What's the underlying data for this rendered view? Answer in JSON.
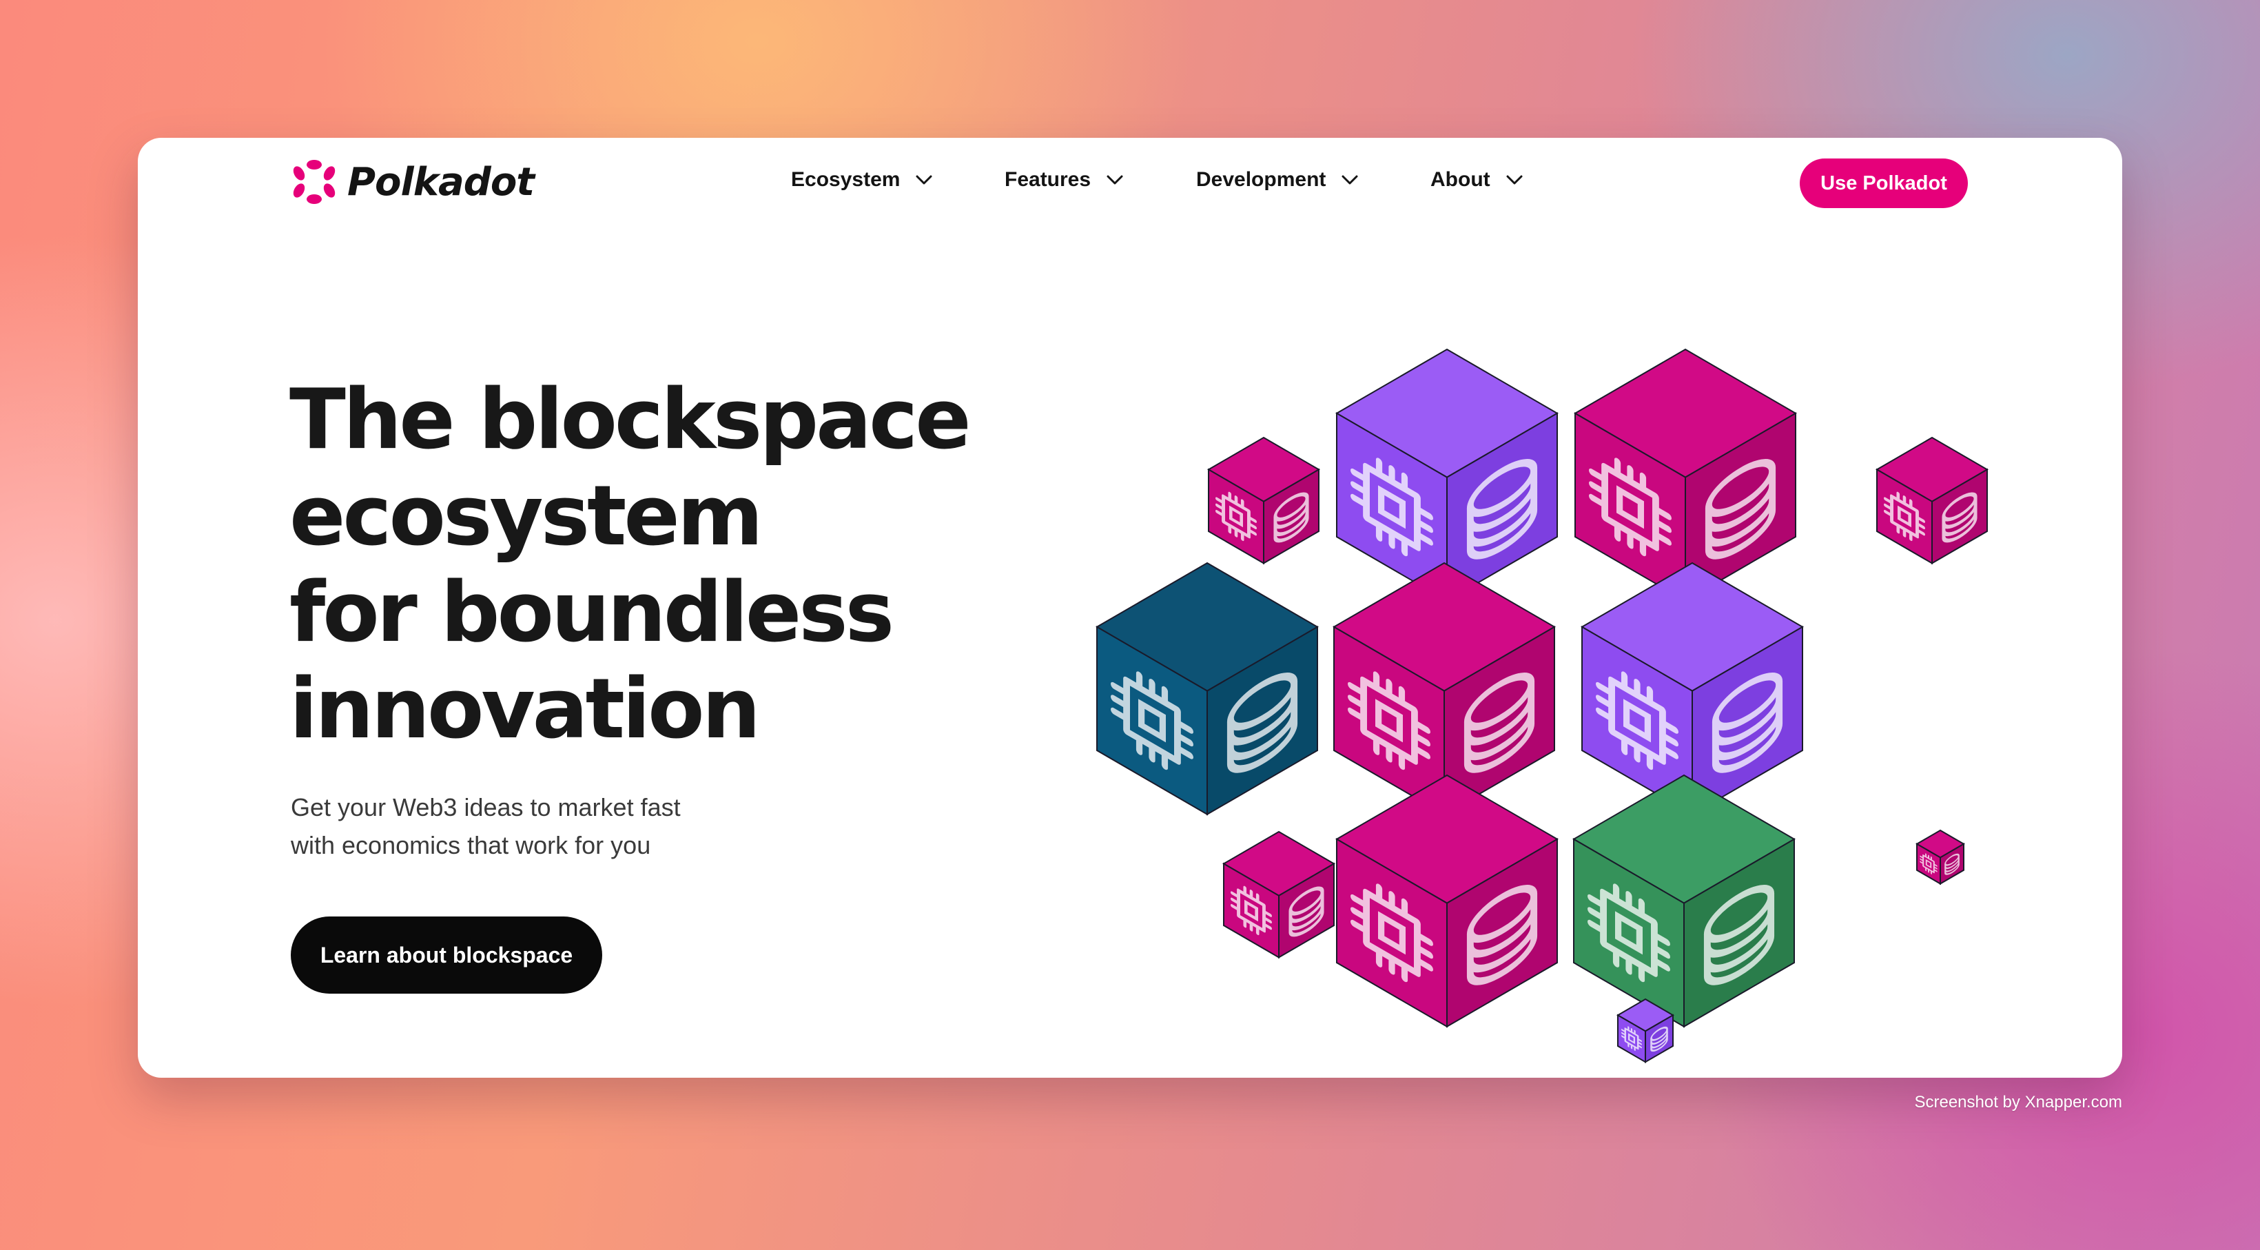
{
  "brand": {
    "name": "Polkadot",
    "accent_color": "#e6007a"
  },
  "nav": {
    "items": [
      {
        "label": "Ecosystem",
        "icon": "chevron-down-icon"
      },
      {
        "label": "Features",
        "icon": "chevron-down-icon"
      },
      {
        "label": "Development",
        "icon": "chevron-down-icon"
      },
      {
        "label": "About",
        "icon": "chevron-down-icon"
      }
    ],
    "cta_label": "Use Polkadot"
  },
  "hero": {
    "title_lines": [
      "The blockspace",
      "ecosystem",
      "for boundless",
      "innovation"
    ],
    "subtitle_lines": [
      "Get your Web3 ideas to market fast",
      "with economics that work for you"
    ],
    "button_label": "Learn about blockspace"
  },
  "illustration": {
    "cube_icons": [
      "chip-icon",
      "coin-stack-icon"
    ],
    "cube_colors": [
      "#e6007a",
      "#8b45f0",
      "#064b6e",
      "#2f8a55"
    ]
  },
  "footer": {
    "credit": "Screenshot by Xnapper.com"
  }
}
